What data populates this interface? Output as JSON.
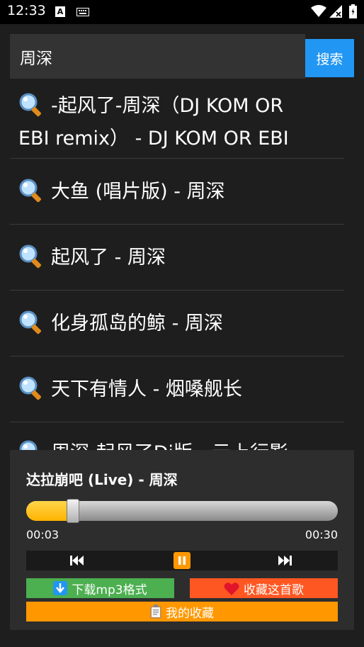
{
  "status_bar": {
    "time": "12:33",
    "a_icon_letter": "A"
  },
  "search": {
    "value": "周深",
    "button_label": "搜索"
  },
  "results": [
    {
      "line1": "-起风了-周深（DJ KOM OR",
      "line2": "EBI remix） - DJ KOM OR EBI"
    },
    {
      "label": "大鱼 (唱片版) - 周深"
    },
    {
      "label": "起风了 - 周深"
    },
    {
      "label": "化身孤岛的鲸 - 周深"
    },
    {
      "label": "天下有情人 - 烟嗓舰长"
    },
    {
      "label": "周深-起风了Dj版 - 云上行影"
    }
  ],
  "player": {
    "title": "达拉崩吧 (Live) - 周深",
    "current_time": "00:03",
    "total_time": "00:30",
    "progress": 0.1,
    "download_label": "下载mp3格式",
    "favorite_label": "收藏这首歌",
    "my_favorites_label": "我的收藏",
    "icons": {
      "download": "down-arrow-icon",
      "favorite": "heart-icon",
      "my_favorites": "clipboard-icon",
      "prev": "skip-previous-icon",
      "pause": "pause-icon",
      "next": "skip-next-icon"
    }
  },
  "colors": {
    "background": "#1e1e1e",
    "search_button": "#2196f3",
    "progress_fill": "#ffb300",
    "download_button": "#4caf50",
    "favorite_button": "#ff5722",
    "my_favorites_button": "#ff9800"
  }
}
